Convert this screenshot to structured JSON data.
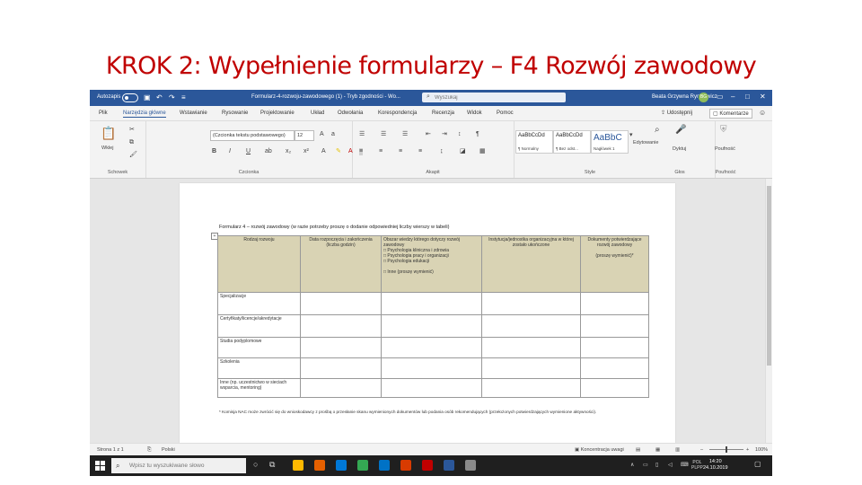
{
  "slide": {
    "title": "KROK 2: Wypełnienie formularzy – F4 Rozwój zawodowy"
  },
  "titlebar": {
    "autosave_label": "Autozapis",
    "document_title": "Formularz-4-rozwoju-zawodowego (1) - Tryb zgodności - Wo...",
    "search_placeholder": "Wyszukaj",
    "user_name": "Beata Grzywna Rynkiewicz",
    "user_initials": "BG",
    "color_bar": "#2b579a"
  },
  "menu": {
    "tabs": [
      "Plik",
      "Narzędzia główne",
      "Wstawianie",
      "Rysowanie",
      "Projektowanie",
      "Układ",
      "Odwołania",
      "Korespondencja",
      "Recenzja",
      "Widok",
      "Pomoc"
    ],
    "active_index": 1,
    "share_label": "Udostępnij",
    "comments_label": "Komentarze"
  },
  "ribbon": {
    "groups": [
      "Schowek",
      "Czcionka",
      "Akapit",
      "Style",
      "Głos",
      "Poufność"
    ],
    "paste_label": "Wklej",
    "font_name": "(Czcionka tekstu podstawowego)",
    "font_size": "12",
    "styles": [
      {
        "sample": "AaBbCcDd",
        "name": "¶ Normalny"
      },
      {
        "sample": "AaBbCcDd",
        "name": "¶ Bez odst..."
      },
      {
        "sample": "AaBbC",
        "name": "Nagłówek 1"
      }
    ],
    "editing_label": "Edytowanie",
    "dictate_label": "Dyktuj",
    "sensitivity_label": "Poufność"
  },
  "document": {
    "heading": "Formularz 4 – rozwój zawodowy (w razie potrzeby proszę o dodanie odpowiedniej liczby wierszy w tabeli)",
    "columns": [
      "Rodzaj rozwoju",
      "Data rozpoczęcia i zakończenia (liczba godzin)",
      "Obszar wiedzy którego dotyczy rozwój zawodowy",
      "Instytucja/jednostka organizacyjna w której zostało ukończone",
      "Dokumenty potwierdzające rozwój zawodowy"
    ],
    "col3_options": [
      "□ Psychologia kliniczna i zdrowia",
      "□ Psychologia pracy i organizacji",
      "□ Psychologia edukacji",
      "□ Inne (proszę wymienić)"
    ],
    "col5_note": "(proszę wymienić)*",
    "rows": [
      "Specjalizacje",
      "Certyfikaty/licencje/akredytacje",
      "Studia podyplomowe",
      "Szkolenia",
      "Inne (np. uczestnictwo w sieciach wsparcia, mentoring)"
    ],
    "footnote": "* Komisja NAC może zwrócić się do wnioskodawcy z prośbą o przesłanie skanu wymienionych dokumentów lub podania osób rekomendujących (przełożonych potwierdzających wymienione aktywności)."
  },
  "statusbar": {
    "page": "Strona 1 z 1",
    "language": "Polski",
    "focus_label": "Koncentracja uwagi",
    "zoom": "100%",
    "zoom_fraction": 0.5
  },
  "taskbar": {
    "search_placeholder": "Wpisz tu wyszukiwane słowo",
    "lang": "POL",
    "lang2": "PLPP",
    "time": "14:20",
    "date": "24.10.2019",
    "app_colors": [
      "#ffb900",
      "#e66000",
      "#0078d7",
      "#34a853",
      "#0072c6",
      "#d83b01",
      "#c00000",
      "#2b579a",
      "#8a8a8a"
    ]
  }
}
